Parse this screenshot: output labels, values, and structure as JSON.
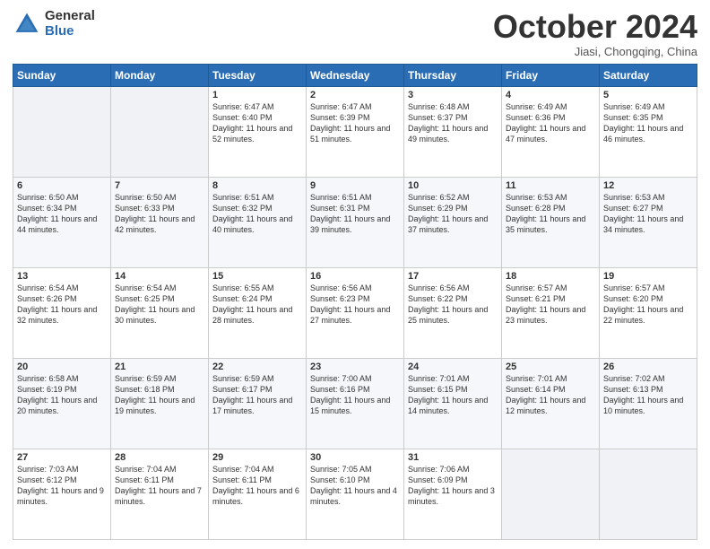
{
  "header": {
    "logo_general": "General",
    "logo_blue": "Blue",
    "month_title": "October 2024",
    "subtitle": "Jiasi, Chongqing, China"
  },
  "weekdays": [
    "Sunday",
    "Monday",
    "Tuesday",
    "Wednesday",
    "Thursday",
    "Friday",
    "Saturday"
  ],
  "weeks": [
    [
      {
        "day": "",
        "content": ""
      },
      {
        "day": "",
        "content": ""
      },
      {
        "day": "1",
        "content": "Sunrise: 6:47 AM\nSunset: 6:40 PM\nDaylight: 11 hours and 52 minutes."
      },
      {
        "day": "2",
        "content": "Sunrise: 6:47 AM\nSunset: 6:39 PM\nDaylight: 11 hours and 51 minutes."
      },
      {
        "day": "3",
        "content": "Sunrise: 6:48 AM\nSunset: 6:37 PM\nDaylight: 11 hours and 49 minutes."
      },
      {
        "day": "4",
        "content": "Sunrise: 6:49 AM\nSunset: 6:36 PM\nDaylight: 11 hours and 47 minutes."
      },
      {
        "day": "5",
        "content": "Sunrise: 6:49 AM\nSunset: 6:35 PM\nDaylight: 11 hours and 46 minutes."
      }
    ],
    [
      {
        "day": "6",
        "content": "Sunrise: 6:50 AM\nSunset: 6:34 PM\nDaylight: 11 hours and 44 minutes."
      },
      {
        "day": "7",
        "content": "Sunrise: 6:50 AM\nSunset: 6:33 PM\nDaylight: 11 hours and 42 minutes."
      },
      {
        "day": "8",
        "content": "Sunrise: 6:51 AM\nSunset: 6:32 PM\nDaylight: 11 hours and 40 minutes."
      },
      {
        "day": "9",
        "content": "Sunrise: 6:51 AM\nSunset: 6:31 PM\nDaylight: 11 hours and 39 minutes."
      },
      {
        "day": "10",
        "content": "Sunrise: 6:52 AM\nSunset: 6:29 PM\nDaylight: 11 hours and 37 minutes."
      },
      {
        "day": "11",
        "content": "Sunrise: 6:53 AM\nSunset: 6:28 PM\nDaylight: 11 hours and 35 minutes."
      },
      {
        "day": "12",
        "content": "Sunrise: 6:53 AM\nSunset: 6:27 PM\nDaylight: 11 hours and 34 minutes."
      }
    ],
    [
      {
        "day": "13",
        "content": "Sunrise: 6:54 AM\nSunset: 6:26 PM\nDaylight: 11 hours and 32 minutes."
      },
      {
        "day": "14",
        "content": "Sunrise: 6:54 AM\nSunset: 6:25 PM\nDaylight: 11 hours and 30 minutes."
      },
      {
        "day": "15",
        "content": "Sunrise: 6:55 AM\nSunset: 6:24 PM\nDaylight: 11 hours and 28 minutes."
      },
      {
        "day": "16",
        "content": "Sunrise: 6:56 AM\nSunset: 6:23 PM\nDaylight: 11 hours and 27 minutes."
      },
      {
        "day": "17",
        "content": "Sunrise: 6:56 AM\nSunset: 6:22 PM\nDaylight: 11 hours and 25 minutes."
      },
      {
        "day": "18",
        "content": "Sunrise: 6:57 AM\nSunset: 6:21 PM\nDaylight: 11 hours and 23 minutes."
      },
      {
        "day": "19",
        "content": "Sunrise: 6:57 AM\nSunset: 6:20 PM\nDaylight: 11 hours and 22 minutes."
      }
    ],
    [
      {
        "day": "20",
        "content": "Sunrise: 6:58 AM\nSunset: 6:19 PM\nDaylight: 11 hours and 20 minutes."
      },
      {
        "day": "21",
        "content": "Sunrise: 6:59 AM\nSunset: 6:18 PM\nDaylight: 11 hours and 19 minutes."
      },
      {
        "day": "22",
        "content": "Sunrise: 6:59 AM\nSunset: 6:17 PM\nDaylight: 11 hours and 17 minutes."
      },
      {
        "day": "23",
        "content": "Sunrise: 7:00 AM\nSunset: 6:16 PM\nDaylight: 11 hours and 15 minutes."
      },
      {
        "day": "24",
        "content": "Sunrise: 7:01 AM\nSunset: 6:15 PM\nDaylight: 11 hours and 14 minutes."
      },
      {
        "day": "25",
        "content": "Sunrise: 7:01 AM\nSunset: 6:14 PM\nDaylight: 11 hours and 12 minutes."
      },
      {
        "day": "26",
        "content": "Sunrise: 7:02 AM\nSunset: 6:13 PM\nDaylight: 11 hours and 10 minutes."
      }
    ],
    [
      {
        "day": "27",
        "content": "Sunrise: 7:03 AM\nSunset: 6:12 PM\nDaylight: 11 hours and 9 minutes."
      },
      {
        "day": "28",
        "content": "Sunrise: 7:04 AM\nSunset: 6:11 PM\nDaylight: 11 hours and 7 minutes."
      },
      {
        "day": "29",
        "content": "Sunrise: 7:04 AM\nSunset: 6:11 PM\nDaylight: 11 hours and 6 minutes."
      },
      {
        "day": "30",
        "content": "Sunrise: 7:05 AM\nSunset: 6:10 PM\nDaylight: 11 hours and 4 minutes."
      },
      {
        "day": "31",
        "content": "Sunrise: 7:06 AM\nSunset: 6:09 PM\nDaylight: 11 hours and 3 minutes."
      },
      {
        "day": "",
        "content": ""
      },
      {
        "day": "",
        "content": ""
      }
    ]
  ]
}
